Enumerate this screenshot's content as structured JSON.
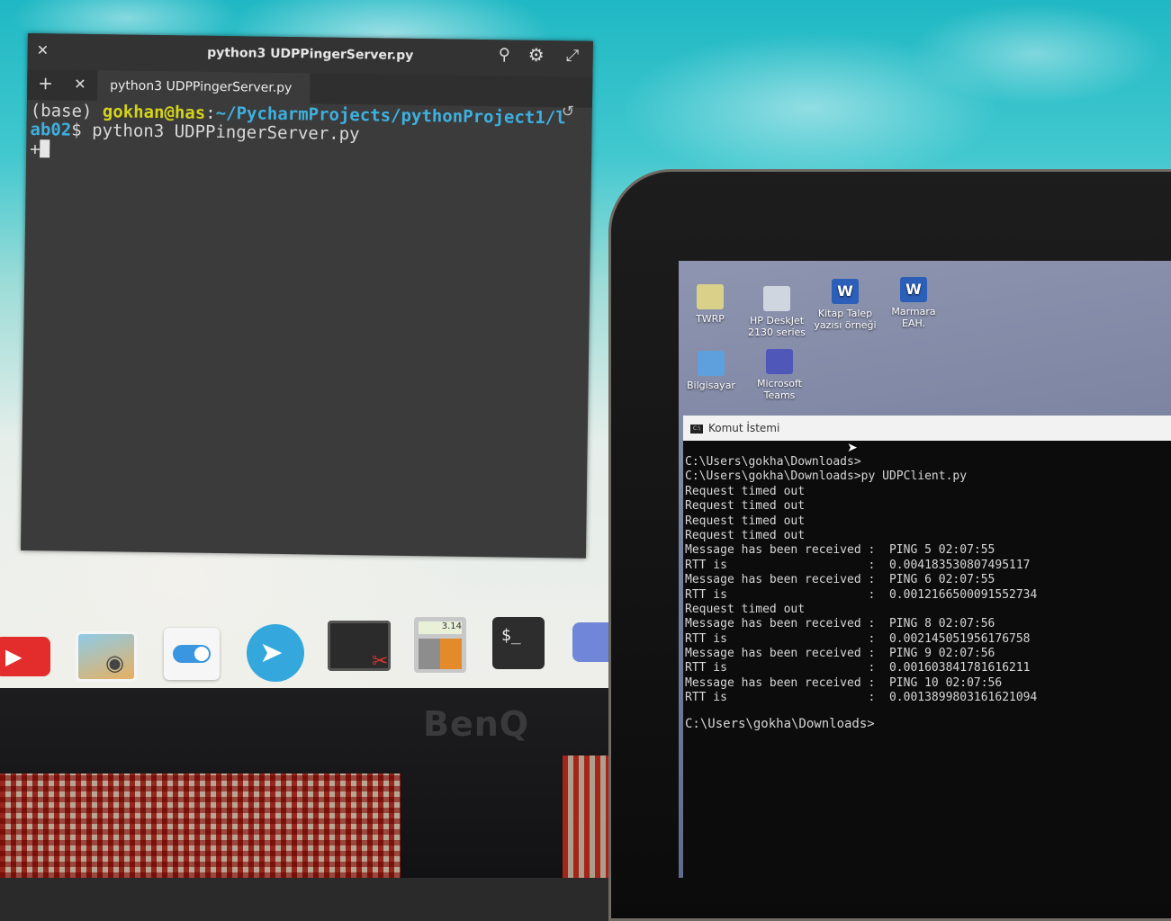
{
  "monitor": {
    "brand": "BenQ"
  },
  "terminal": {
    "window_title": "python3 UDPPingerServer.py",
    "tab_label": "python3 UDPPingerServer.py",
    "prompt_base": "(base) ",
    "prompt_user": "gokhan@has",
    "prompt_sep": ":",
    "prompt_path_1": "~/PycharmProjects/pythonProject1/l",
    "prompt_path_2": "ab02",
    "prompt_end": "$ ",
    "command": "python3 UDPPingerServer.py",
    "cursor_prefix": "+"
  },
  "dock": {
    "items": [
      "youtube-icon",
      "photos-icon",
      "settings-toggle-icon",
      "telegram-icon",
      "screenshot-icon",
      "calculator-icon",
      "terminal-icon",
      "discord-icon"
    ],
    "calculator_display": "3.14",
    "terminal_glyph": "$_"
  },
  "laptop": {
    "desktop_icons": [
      {
        "label": "TWRP"
      },
      {
        "label": "HP DeskJet 2130 series"
      },
      {
        "label": "Kitap Talep yazısı örneği"
      },
      {
        "label": "Marmara EAH."
      },
      {
        "label": "Bilgisayar"
      },
      {
        "label": "Microsoft Teams"
      }
    ],
    "cmd": {
      "title": "Komut İstemi",
      "lines": [
        "C:\\Users\\gokha\\Downloads>",
        "C:\\Users\\gokha\\Downloads>py UDPClient.py",
        "Request timed out",
        "Request timed out",
        "Request timed out",
        "Request timed out",
        "Message has been received :  PING 5 02:07:55",
        "RTT is                    :  0.004183530807495117",
        "Message has been received :  PING 6 02:07:55",
        "RTT is                    :  0.0012166500091552734",
        "Request timed out",
        "Message has been received :  PING 8 02:07:56",
        "RTT is                    :  0.002145051956176758",
        "Message has been received :  PING 9 02:07:56",
        "RTT is                    :  0.001603841781616211",
        "Message has been received :  PING 10 02:07:56",
        "RTT is                    :  0.0013899803161621094"
      ],
      "final_prompt": "C:\\Users\\gokha\\Downloads>"
    }
  }
}
